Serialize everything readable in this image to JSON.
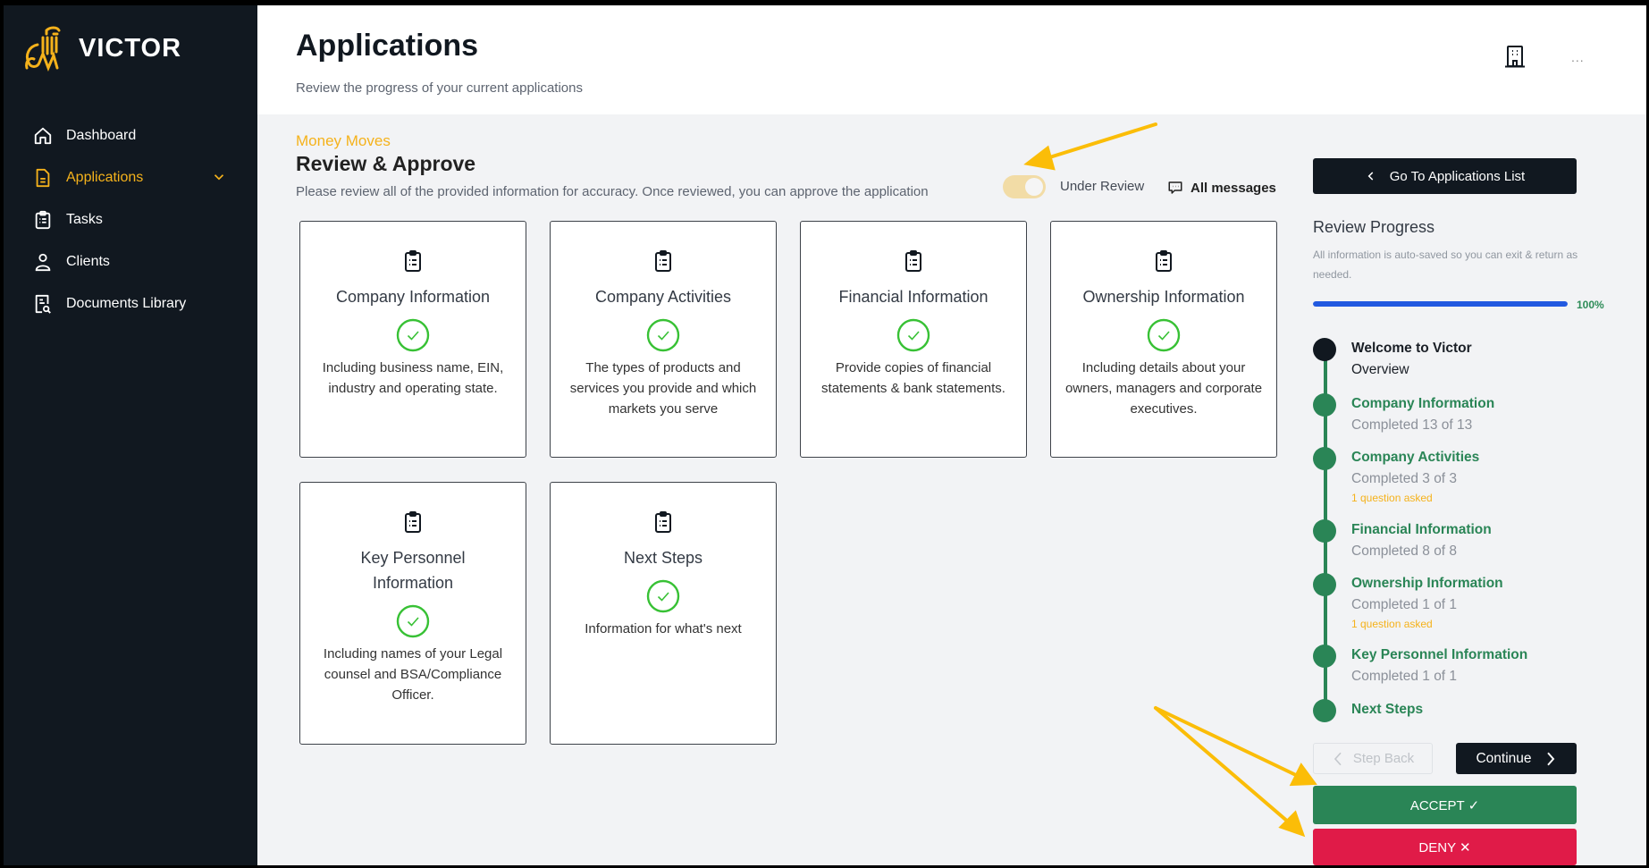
{
  "brand": {
    "name": "VICTOR",
    "accent": "#f5b21b"
  },
  "sidebar": {
    "items": [
      {
        "label": "Dashboard",
        "icon": "home-icon",
        "active": false
      },
      {
        "label": "Applications",
        "icon": "document-icon",
        "active": true
      },
      {
        "label": "Tasks",
        "icon": "clipboard-icon",
        "active": false
      },
      {
        "label": "Clients",
        "icon": "user-icon",
        "active": false
      },
      {
        "label": "Documents Library",
        "icon": "document-search-icon",
        "active": false
      }
    ]
  },
  "header": {
    "title": "Applications",
    "subtitle": "Review the progress of your current applications",
    "icons": [
      "building-icon",
      "more-icon"
    ],
    "more_label": "..."
  },
  "main": {
    "client_name": "Money Moves",
    "section_title": "Review & Approve",
    "section_desc": "Please review all of the provided information for accuracy. Once reviewed, you can approve the application",
    "toggle": {
      "label": "Under Review",
      "on": true
    },
    "messages_label": "All messages",
    "cards": [
      {
        "title": "Company Information",
        "desc": "Including business name, EIN, industry and operating state.",
        "complete": true
      },
      {
        "title": "Company Activities",
        "desc": "The types of products and services you provide and which markets you serve",
        "complete": true
      },
      {
        "title": "Financial Information",
        "desc": "Provide copies of financial statements & bank statements.",
        "complete": true
      },
      {
        "title": "Ownership Information",
        "desc": "Including details about your owners, managers and corporate executives.",
        "complete": true
      },
      {
        "title": "Key Personnel Information",
        "desc": "Including names of your Legal counsel and BSA/Compliance Officer.",
        "complete": true
      },
      {
        "title": "Next Steps",
        "desc": "Information for what's next",
        "complete": true
      }
    ]
  },
  "review_panel": {
    "goto_label": "Go To Applications List",
    "title": "Review Progress",
    "subtitle": "All information is auto-saved so you can exit & return as needed.",
    "progress_percent": 100,
    "progress_label": "100%",
    "steps": [
      {
        "title": "Welcome to Victor",
        "sub": "Overview",
        "note": ""
      },
      {
        "title": "Company Information",
        "sub": "Completed 13 of 13",
        "note": ""
      },
      {
        "title": "Company Activities",
        "sub": "Completed 3 of 3",
        "note": "1 question asked"
      },
      {
        "title": "Financial Information",
        "sub": "Completed 8 of 8",
        "note": ""
      },
      {
        "title": "Ownership Information",
        "sub": "Completed 1 of 1",
        "note": "1 question asked"
      },
      {
        "title": "Key Personnel Information",
        "sub": "Completed 1 of 1",
        "note": ""
      },
      {
        "title": "Next Steps",
        "sub": "",
        "note": ""
      }
    ],
    "step_back_label": "Step Back",
    "continue_label": "Continue",
    "accept_label": "ACCEPT ✓",
    "deny_label": "DENY ✕",
    "colors": {
      "success": "#2a8556",
      "danger": "#e01b48",
      "progress": "#2259e0"
    }
  }
}
